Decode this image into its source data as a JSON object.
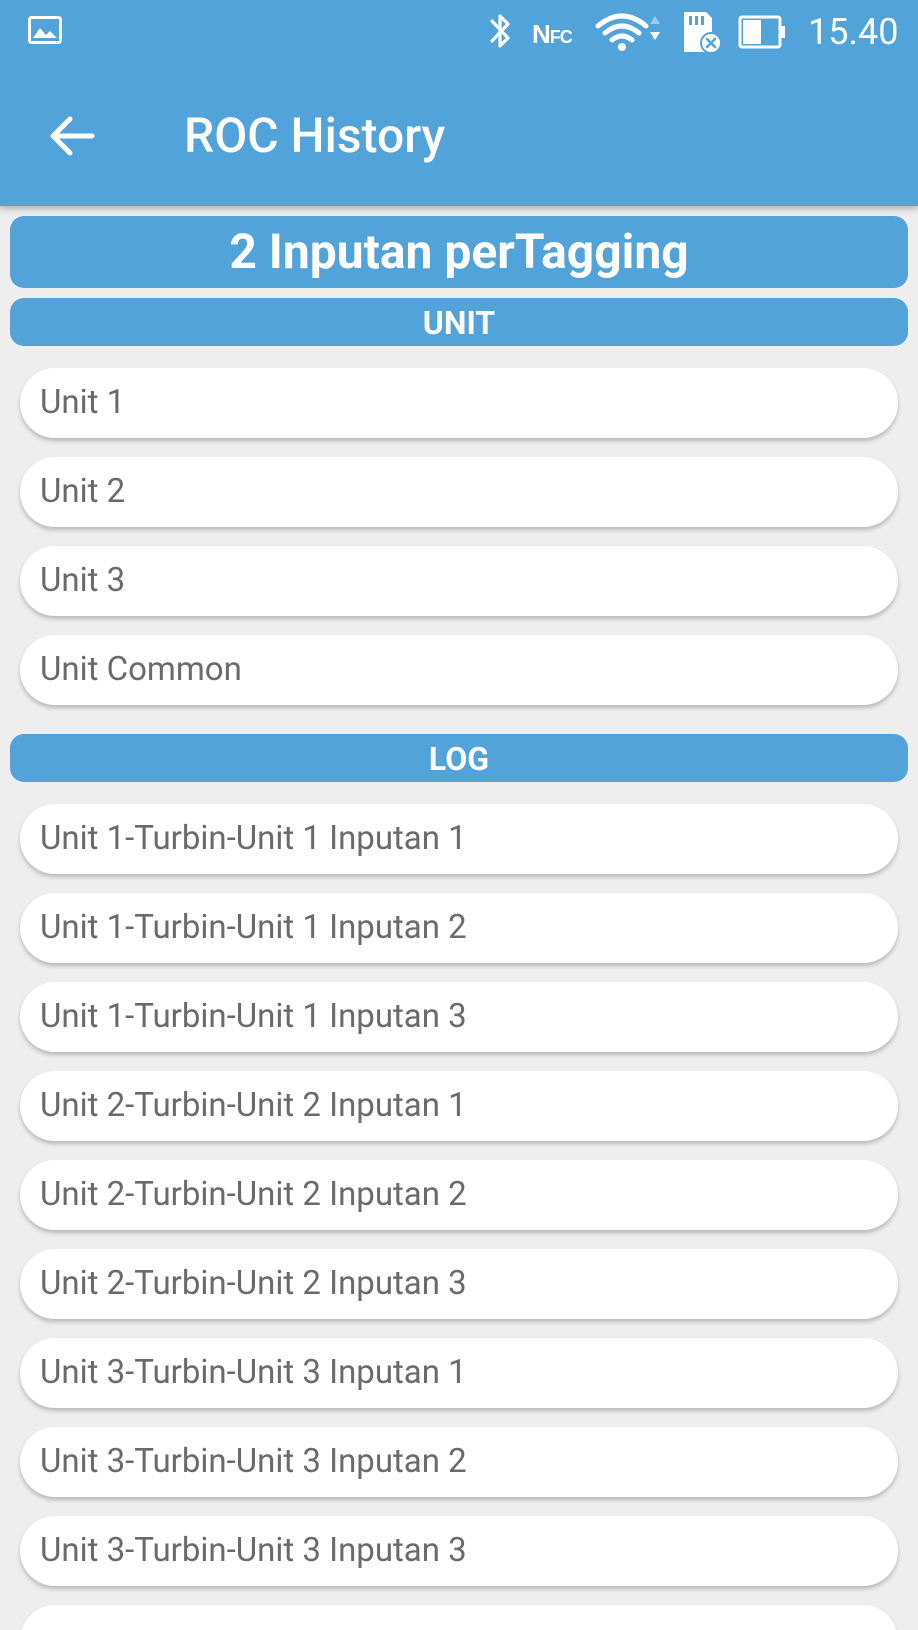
{
  "status_bar": {
    "time": "15.40",
    "icons": [
      "gallery-icon",
      "bluetooth-icon",
      "nfc-icon",
      "wifi-icon",
      "sd-card-icon",
      "battery-icon"
    ],
    "nfc_label_n": "N",
    "nfc_label_fc": "FC"
  },
  "toolbar": {
    "title": "ROC History",
    "back_icon": "arrow-left-icon"
  },
  "main_header": "2 Inputan perTagging",
  "sections": {
    "unit": {
      "title": "UNIT",
      "items": [
        "Unit 1",
        "Unit 2",
        "Unit 3",
        "Unit Common"
      ]
    },
    "log": {
      "title": "LOG",
      "items": [
        "Unit 1-Turbin-Unit 1 Inputan 1",
        "Unit 1-Turbin-Unit 1 Inputan 2",
        "Unit 1-Turbin-Unit 1 Inputan 3",
        "Unit 2-Turbin-Unit 2 Inputan 1",
        "Unit 2-Turbin-Unit 2 Inputan 2",
        "Unit 2-Turbin-Unit 2 Inputan 3",
        "Unit 3-Turbin-Unit 3 Inputan 1",
        "Unit 3-Turbin-Unit 3 Inputan 2",
        "Unit 3-Turbin-Unit 3 Inputan 3",
        ""
      ]
    }
  },
  "colors": {
    "primary": "#52a3da",
    "background": "#eeeeee",
    "item_background": "#ffffff",
    "item_text": "#6a6a6a"
  }
}
